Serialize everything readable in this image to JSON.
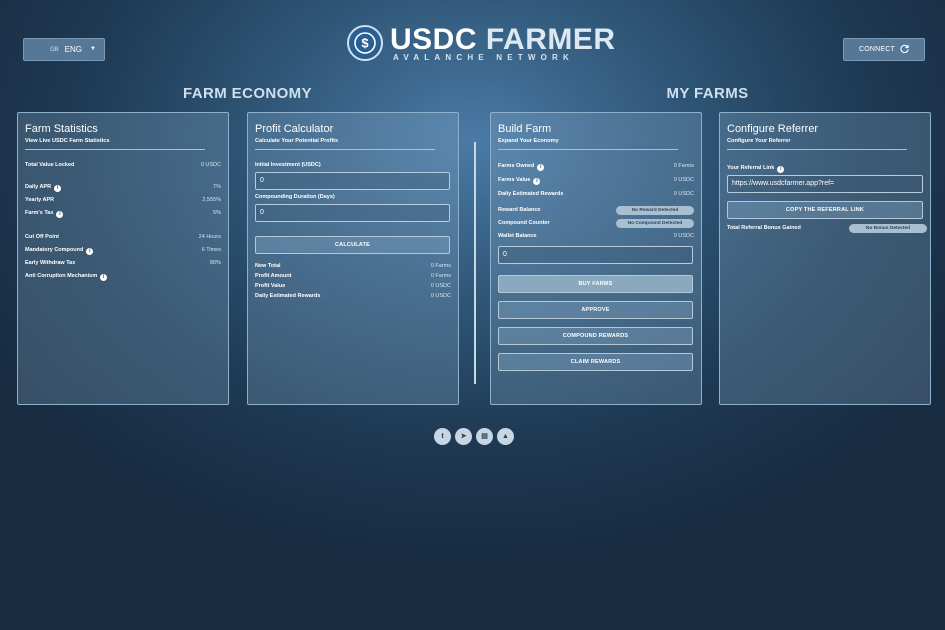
{
  "header": {
    "language": {
      "flag": "GB",
      "value": "ENG"
    },
    "logo": {
      "title_part1": "USDC",
      "title_part2": "FARMER",
      "subtitle": "AVALANCHE NETWORK",
      "icon": "dollar-coin-icon"
    },
    "connect_label": "CONNECT"
  },
  "sections": {
    "economy": "FARM ECONOMY",
    "my_farms": "MY FARMS"
  },
  "farm_statistics": {
    "title": "Farm Statistics",
    "subtitle": "View Live USDC Farm Statistics",
    "tvl_label": "Total Value Locked",
    "tvl_value": "0 USDC",
    "daily_apr_label": "Daily APR",
    "daily_apr_value": "7%",
    "yearly_apr_label": "Yearly APR",
    "yearly_apr_value": "2,555%",
    "farm_tax_label": "Farm's Tax",
    "farm_tax_value": "5%",
    "cutoff_label": "Cut Off Point",
    "cutoff_value": "24 Hours",
    "mandatory_label": "Mandatory Compound",
    "mandatory_value": "6 Times",
    "early_label": "Early Withdraw Tax",
    "early_value": "80%",
    "anti_label": "Anti Corruption Mechanism"
  },
  "profit_calculator": {
    "title": "Profit Calculator",
    "subtitle": "Calculate Your Potential Profits",
    "investment_label": "Initial Investment (USDC)",
    "investment_value": "0",
    "duration_label": "Compounding Duration (Days)",
    "duration_value": "0",
    "calculate_label": "CALCULATE",
    "new_total_label": "New Total",
    "new_total_value": "0 Farms",
    "profit_amount_label": "Profit Amount",
    "profit_amount_value": "0 Farms",
    "profit_value_label": "Profit Value",
    "profit_value_value": "0 USDC",
    "daily_rewards_label": "Daily Estimated Rewards",
    "daily_rewards_value": "0 USDC"
  },
  "build_farm": {
    "title": "Build Farm",
    "subtitle": "Expand Your Economy",
    "owned_label": "Farms Owned",
    "owned_value": "0 Farms",
    "value_label": "Farms Value",
    "value_value": "0 USDC",
    "daily_label": "Daily Estimated Rewards",
    "daily_value": "0 USDC",
    "reward_balance_label": "Reward Balance",
    "reward_balance_value": "No Reward Detected",
    "compound_counter_label": "Compound Counter",
    "compound_counter_value": "No Compound Detected",
    "wallet_label": "Wallet Balance",
    "wallet_value": "0 USDC",
    "amount_value": "0",
    "buy_label": "BUY FARMS",
    "approve_label": "APPROVE",
    "compound_label": "COMPOUND REWARDS",
    "claim_label": "CLAIM REWARDS"
  },
  "referrer": {
    "title": "Configure Referrer",
    "subtitle": "Configure Your Referrer",
    "link_label": "Your Referral Link",
    "link_value": "https://www.usdcfarmer.app?ref=",
    "copy_label": "COPY THE REFERRAL LINK",
    "bonus_label": "Total Referral Bonus Gained",
    "bonus_value": "No Bonus Detected"
  },
  "social": [
    {
      "icon": "twitter-icon",
      "glyph": "t"
    },
    {
      "icon": "telegram-icon",
      "glyph": "➤"
    },
    {
      "icon": "docs-icon",
      "glyph": "▤"
    },
    {
      "icon": "avalanche-icon",
      "glyph": "▲"
    }
  ]
}
